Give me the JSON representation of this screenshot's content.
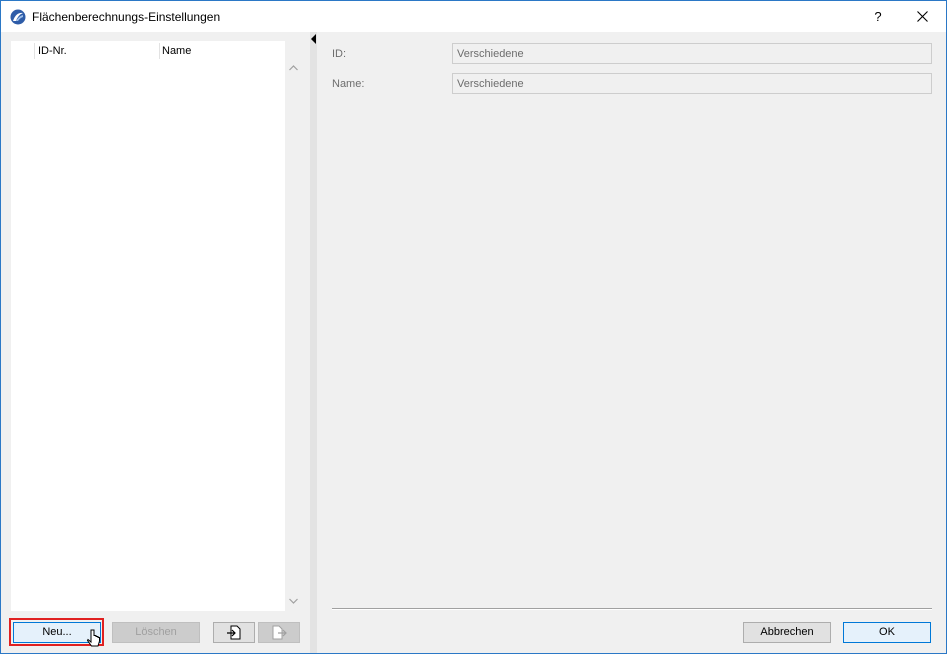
{
  "window": {
    "title": "Flächenberechnungs-Einstellungen",
    "help_label": "?",
    "icons": {
      "app": "archicad-logo-icon",
      "close": "close-icon"
    }
  },
  "list": {
    "columns": [
      "ID-Nr.",
      "Name"
    ],
    "rows": []
  },
  "form": {
    "id_label": "ID:",
    "id_value": "Verschiedene",
    "name_label": "Name:",
    "name_value": "Verschiedene"
  },
  "buttons": {
    "new_label": "Neu...",
    "delete_label": "Löschen",
    "cancel_label": "Abbrechen",
    "ok_label": "OK"
  },
  "colors": {
    "accent": "#0078d7",
    "highlight": "#e02020"
  }
}
